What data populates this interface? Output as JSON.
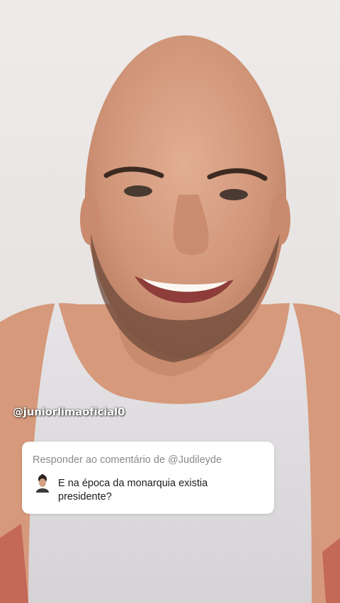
{
  "overlay": {
    "watermark": "@juniorlimaoficial0"
  },
  "reply_card": {
    "header": "Responder ao comentário de @Judileyde",
    "comment": "E na época da monarquia existia presidente?"
  },
  "colors": {
    "card_background": "#ffffff",
    "header_text": "#8a8a8a",
    "comment_text": "#1b1b1b",
    "watermark_text": "#ffffff"
  },
  "icons": {
    "commenter_avatar": "commenter-avatar-icon"
  }
}
